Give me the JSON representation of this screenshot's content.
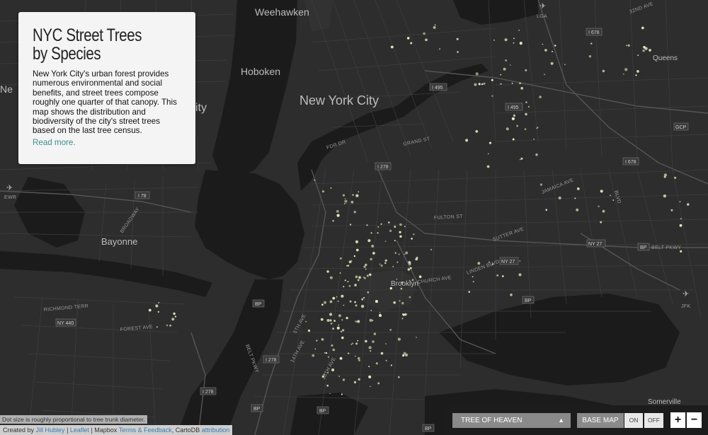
{
  "info_panel": {
    "title_line1": "NYC Street Trees",
    "title_line2": "by Species",
    "description": "New York City's urban forest provides numerous environmental and social benefits, and street trees compose roughly one quarter of that canopy. This map shows the distribution and biodiversity of the city's street trees based on the last tree census.",
    "read_more": "Read more."
  },
  "map": {
    "place_labels": [
      {
        "id": "weehawken",
        "text": "Weehawken",
        "size": "large"
      },
      {
        "id": "hoboken",
        "text": "Hoboken",
        "size": "large"
      },
      {
        "id": "new-york-city",
        "text": "New York City",
        "size": "xlarge"
      },
      {
        "id": "bayonne",
        "text": "Bayonne",
        "size": "large"
      },
      {
        "id": "brooklyn",
        "text": "Brooklyn",
        "size": "small"
      },
      {
        "id": "queens",
        "text": "Queens",
        "size": "small"
      },
      {
        "id": "somerville",
        "text": "Somerville",
        "size": "small"
      },
      {
        "id": "ne-edge",
        "text": "Ne",
        "size": "large"
      },
      {
        "id": "ity-edge",
        "text": "ity",
        "size": "xlarge"
      }
    ],
    "airport_labels": [
      {
        "id": "lga",
        "text": "LGA"
      },
      {
        "id": "ewr",
        "text": "EWR"
      },
      {
        "id": "jfk",
        "text": "JFK"
      }
    ],
    "shields": [
      {
        "id": "i678-a",
        "text": "I 678"
      },
      {
        "id": "i495-a",
        "text": "I 495"
      },
      {
        "id": "i495-b",
        "text": "I 495"
      },
      {
        "id": "i278-a",
        "text": "I 278"
      },
      {
        "id": "i78",
        "text": "I 78"
      },
      {
        "id": "i678-b",
        "text": "I 678"
      },
      {
        "id": "gcp",
        "text": "GCP"
      },
      {
        "id": "ny27-a",
        "text": "NY 27"
      },
      {
        "id": "bp-a",
        "text": "BP"
      },
      {
        "id": "ny27-b",
        "text": "NY 27"
      },
      {
        "id": "bp-b",
        "text": "BP"
      },
      {
        "id": "bp-c",
        "text": "BP"
      },
      {
        "id": "bp-d",
        "text": "BP"
      },
      {
        "id": "i278-b",
        "text": "I 278"
      },
      {
        "id": "i278-c",
        "text": "I 278"
      },
      {
        "id": "bp-e",
        "text": "BP"
      },
      {
        "id": "bp-f",
        "text": "BP"
      },
      {
        "id": "ny440",
        "text": "NY 440"
      }
    ],
    "street_labels": [
      {
        "id": "32nd-ave",
        "text": "32ND AVE"
      },
      {
        "id": "fdr-dr",
        "text": "FDR DR"
      },
      {
        "id": "grand-st",
        "text": "GRAND ST"
      },
      {
        "id": "fulton-st",
        "text": "FULTON ST"
      },
      {
        "id": "sutter-ave",
        "text": "SUTTER AVE"
      },
      {
        "id": "jamaica-ave",
        "text": "JAMAICA AVE"
      },
      {
        "id": "linden-blvd",
        "text": "LINDEN BLVD"
      },
      {
        "id": "church-ave",
        "text": "CHURCH AVE"
      },
      {
        "id": "belt-pkwy",
        "text": "BELT PKWY"
      },
      {
        "id": "richmond-terr",
        "text": "RICHMOND TERR"
      },
      {
        "id": "forest-ave",
        "text": "FOREST AVE"
      },
      {
        "id": "5th-ave",
        "text": "5TH AVE"
      },
      {
        "id": "14th-ave",
        "text": "14TH AVE"
      },
      {
        "id": "18th-ave",
        "text": "18TH AVE"
      },
      {
        "id": "belt-pkwy-2",
        "text": "BELT PKWY"
      },
      {
        "id": "broadway",
        "text": "BROADWAY"
      },
      {
        "id": "rockaway",
        "text": "BLVD"
      }
    ]
  },
  "note": "Dot size is roughly proportional to tree trunk diameter.",
  "attribution": {
    "created_by": "Created by",
    "author": "Jill Hubley",
    "leaflet": "Leaflet",
    "mapbox": "Mapbox",
    "terms": "Terms & Feedback",
    "cartodb": "CartoDB",
    "attribution_link": "attribution"
  },
  "controls": {
    "species_selected": "TREE OF HEAVEN",
    "species_arrow": "▲",
    "base_map_label": "BASE MAP",
    "on_label": "ON",
    "off_label": "OFF",
    "zoom_in": "+",
    "zoom_out": "−"
  },
  "colors": {
    "background": "#2b2b2b",
    "water": "#1a1a1a",
    "roads": "#3d3d3d",
    "tree_dot": "#eeeec4",
    "panel": "#f4f4f4",
    "link": "#3c8f8f"
  }
}
